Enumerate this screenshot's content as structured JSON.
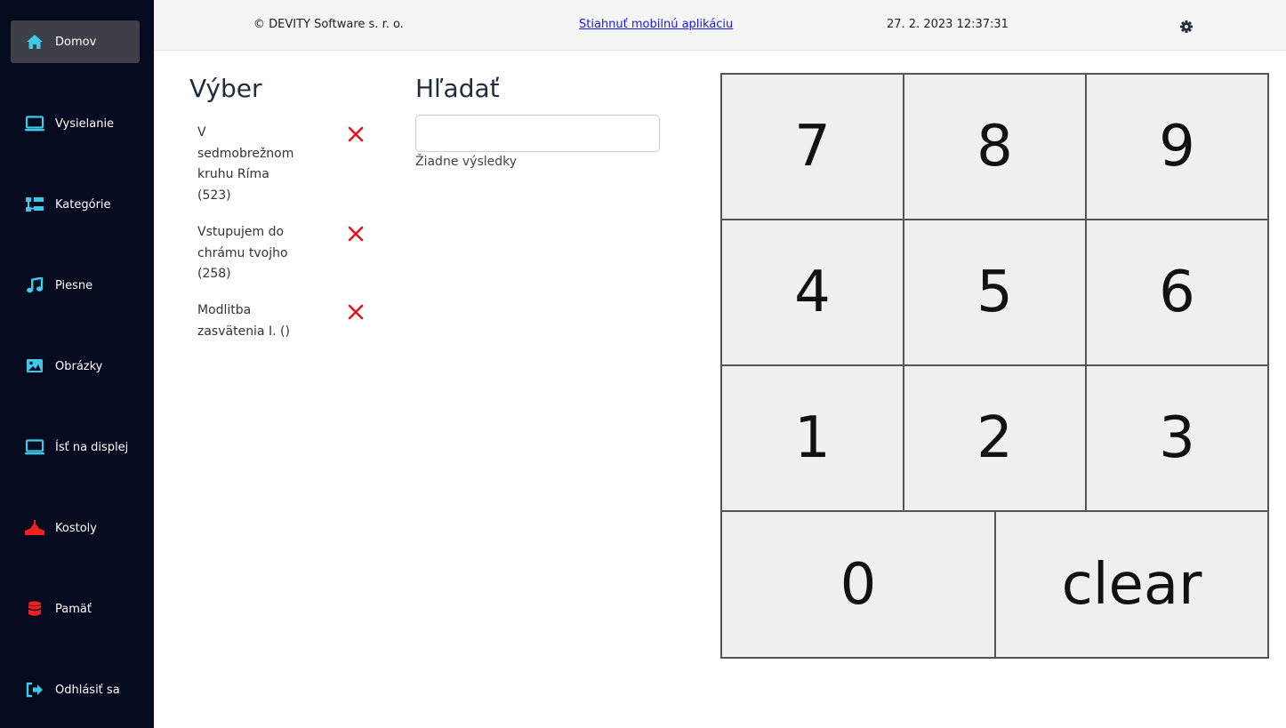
{
  "sidebar": {
    "items": [
      {
        "label": "Domov",
        "icon": "home-icon",
        "icon_color": "#3ec7e6",
        "active": true
      },
      {
        "label": "Vysielanie",
        "icon": "monitor-icon",
        "icon_color": "#3ec7e6"
      },
      {
        "label": "Kategórie",
        "icon": "sitemap-icon",
        "icon_color": "#3ec7e6"
      },
      {
        "label": "Piesne",
        "icon": "music-icon",
        "icon_color": "#3ec7e6"
      },
      {
        "label": "Obrázky",
        "icon": "image-icon",
        "icon_color": "#3ec7e6"
      },
      {
        "label": "Ísť na displej",
        "icon": "monitor-icon",
        "icon_color": "#3ec7e6"
      },
      {
        "label": "Kostoly",
        "icon": "church-icon",
        "icon_color": "#e22"
      },
      {
        "label": "Pamäť",
        "icon": "database-icon",
        "icon_color": "#e22"
      },
      {
        "label": "Odhlásiť sa",
        "icon": "sign-out-icon",
        "icon_color": "#3ec7e6"
      }
    ]
  },
  "header": {
    "copyright": "© DEVITY Software s. r. o.",
    "mobile_link": "Stiahnuť mobilnú aplikáciu",
    "datetime": "27. 2. 2023 12:37:31",
    "settings_icon": "gear-icon"
  },
  "selection": {
    "title": "Výber",
    "items": [
      {
        "name": "V sedmobrežnom kruhu Ríma (523)",
        "lines": [
          "V",
          "sedmobrežnom",
          "kruhu Ríma",
          "(523)"
        ]
      },
      {
        "name": "Vstupujem do chrámu tvojho (258)",
        "lines": [
          "Vstupujem do",
          "chrámu tvojho",
          "(258)"
        ]
      },
      {
        "name": "Modlitba zasvätenia I. ()",
        "lines": [
          "Modlitba",
          "zasvätenia I. ()"
        ]
      }
    ],
    "remove_icon": "close-icon",
    "remove_color": "#e8121e"
  },
  "search": {
    "title": "Hľadať",
    "value": "",
    "no_results": "Žiadne výsledky"
  },
  "keypad": {
    "keys": [
      "7",
      "8",
      "9",
      "4",
      "5",
      "6",
      "1",
      "2",
      "3",
      "0",
      "clear"
    ]
  }
}
